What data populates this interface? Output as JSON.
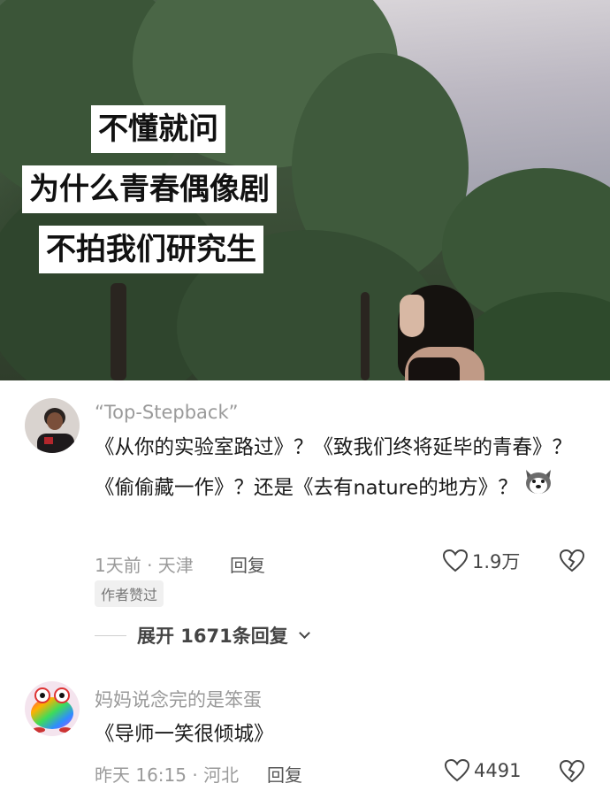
{
  "video": {
    "caption_lines": [
      "不懂就问",
      "为什么青春偶像剧",
      "不拍我们研究生"
    ]
  },
  "comments": [
    {
      "username": "“Top-Stepback”",
      "text": "《从你的实验室路过》？《致我们终将延毕的青春》？《偷偷藏一作》？还是《去有nature的地方》？",
      "emoji_icon": "husky-dog-emoji-icon",
      "time_location": "1天前 · 天津",
      "reply_label": "回复",
      "like_count": "1.9万",
      "badge": "作者赞过",
      "expand_label": "展开 1671条回复"
    },
    {
      "username": "妈妈说念完的是笨蛋",
      "text": "《导师一笑很倾城》",
      "time_location": "昨天 16:15 · 河北",
      "reply_label": "回复",
      "like_count": "4491"
    }
  ],
  "colors": {
    "meta_gray": "#9a9a9a",
    "text_dark": "#1a1a1a",
    "badge_bg": "#f0f0f0"
  }
}
